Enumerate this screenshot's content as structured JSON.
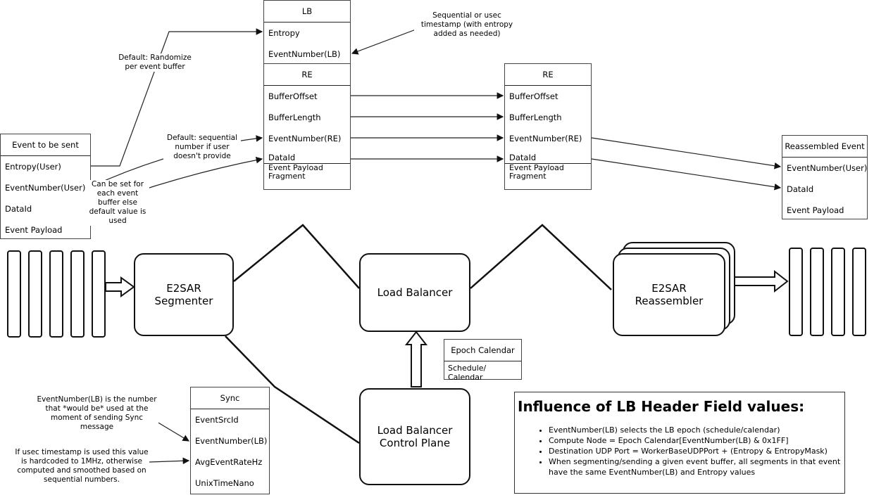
{
  "lb_header": {
    "title": "LB",
    "fields": [
      "Entropy",
      "EventNumber(LB)"
    ]
  },
  "re_header_left": {
    "title": "RE",
    "fields": [
      "BufferOffset",
      "BufferLength",
      "EventNumber(RE)",
      "DataId"
    ],
    "payload": "Event Payload Fragment"
  },
  "re_header_right": {
    "title": "RE",
    "fields": [
      "BufferOffset",
      "BufferLength",
      "EventNumber(RE)",
      "DataId"
    ],
    "payload": "Event Payload Fragment"
  },
  "event_to_send": {
    "title": "Event to be sent",
    "fields": [
      "Entropy(User)",
      "EventNumber(User)",
      "DataId",
      "Event Payload"
    ]
  },
  "reassembled": {
    "title": "Reassembled Event",
    "fields": [
      "EventNumber(User)",
      "DataId",
      "Event Payload"
    ]
  },
  "sync": {
    "title": "Sync",
    "fields": [
      "EventSrcId",
      "EventNumber(LB)",
      "AvgEventRateHz",
      "UnixTimeNano"
    ]
  },
  "epoch": {
    "title": "Epoch Calendar",
    "body": "Schedule/ Calendar"
  },
  "nodes": {
    "segmenter": "E2SAR Segmenter",
    "lb": "Load Balancer",
    "reassembler": "E2SAR Reassembler",
    "control": "Load Balancer Control Plane"
  },
  "notes": {
    "randomize": "Default: Randomize per event buffer",
    "sequential": "Sequential or usec timestamp (with entropy added as needed)",
    "default_seq": "Default: sequential number if user doesn't provide",
    "dataid": "Can be set for each event buffer else default value is used",
    "sync_en": "EventNumber(LB) is the number that *would be* used at the moment of sending Sync message",
    "sync_rate": "If usec timestamp is used this value is hardcoded to 1MHz, otherwise computed and smoothed based on sequential numbers."
  },
  "influence": {
    "title": "Influence of LB Header Field values:",
    "items": [
      "EventNumber(LB) selects the LB epoch (schedule/calendar)",
      "Compute Node = Epoch Calendar[EventNumber(LB) & 0x1FF]",
      "Destination UDP Port = WorkerBaseUDPPort + (Entropy & EntropyMask)",
      "When segmenting/sending a given event buffer, all segments in that event have the same EventNumber(LB) and Entropy values"
    ]
  }
}
